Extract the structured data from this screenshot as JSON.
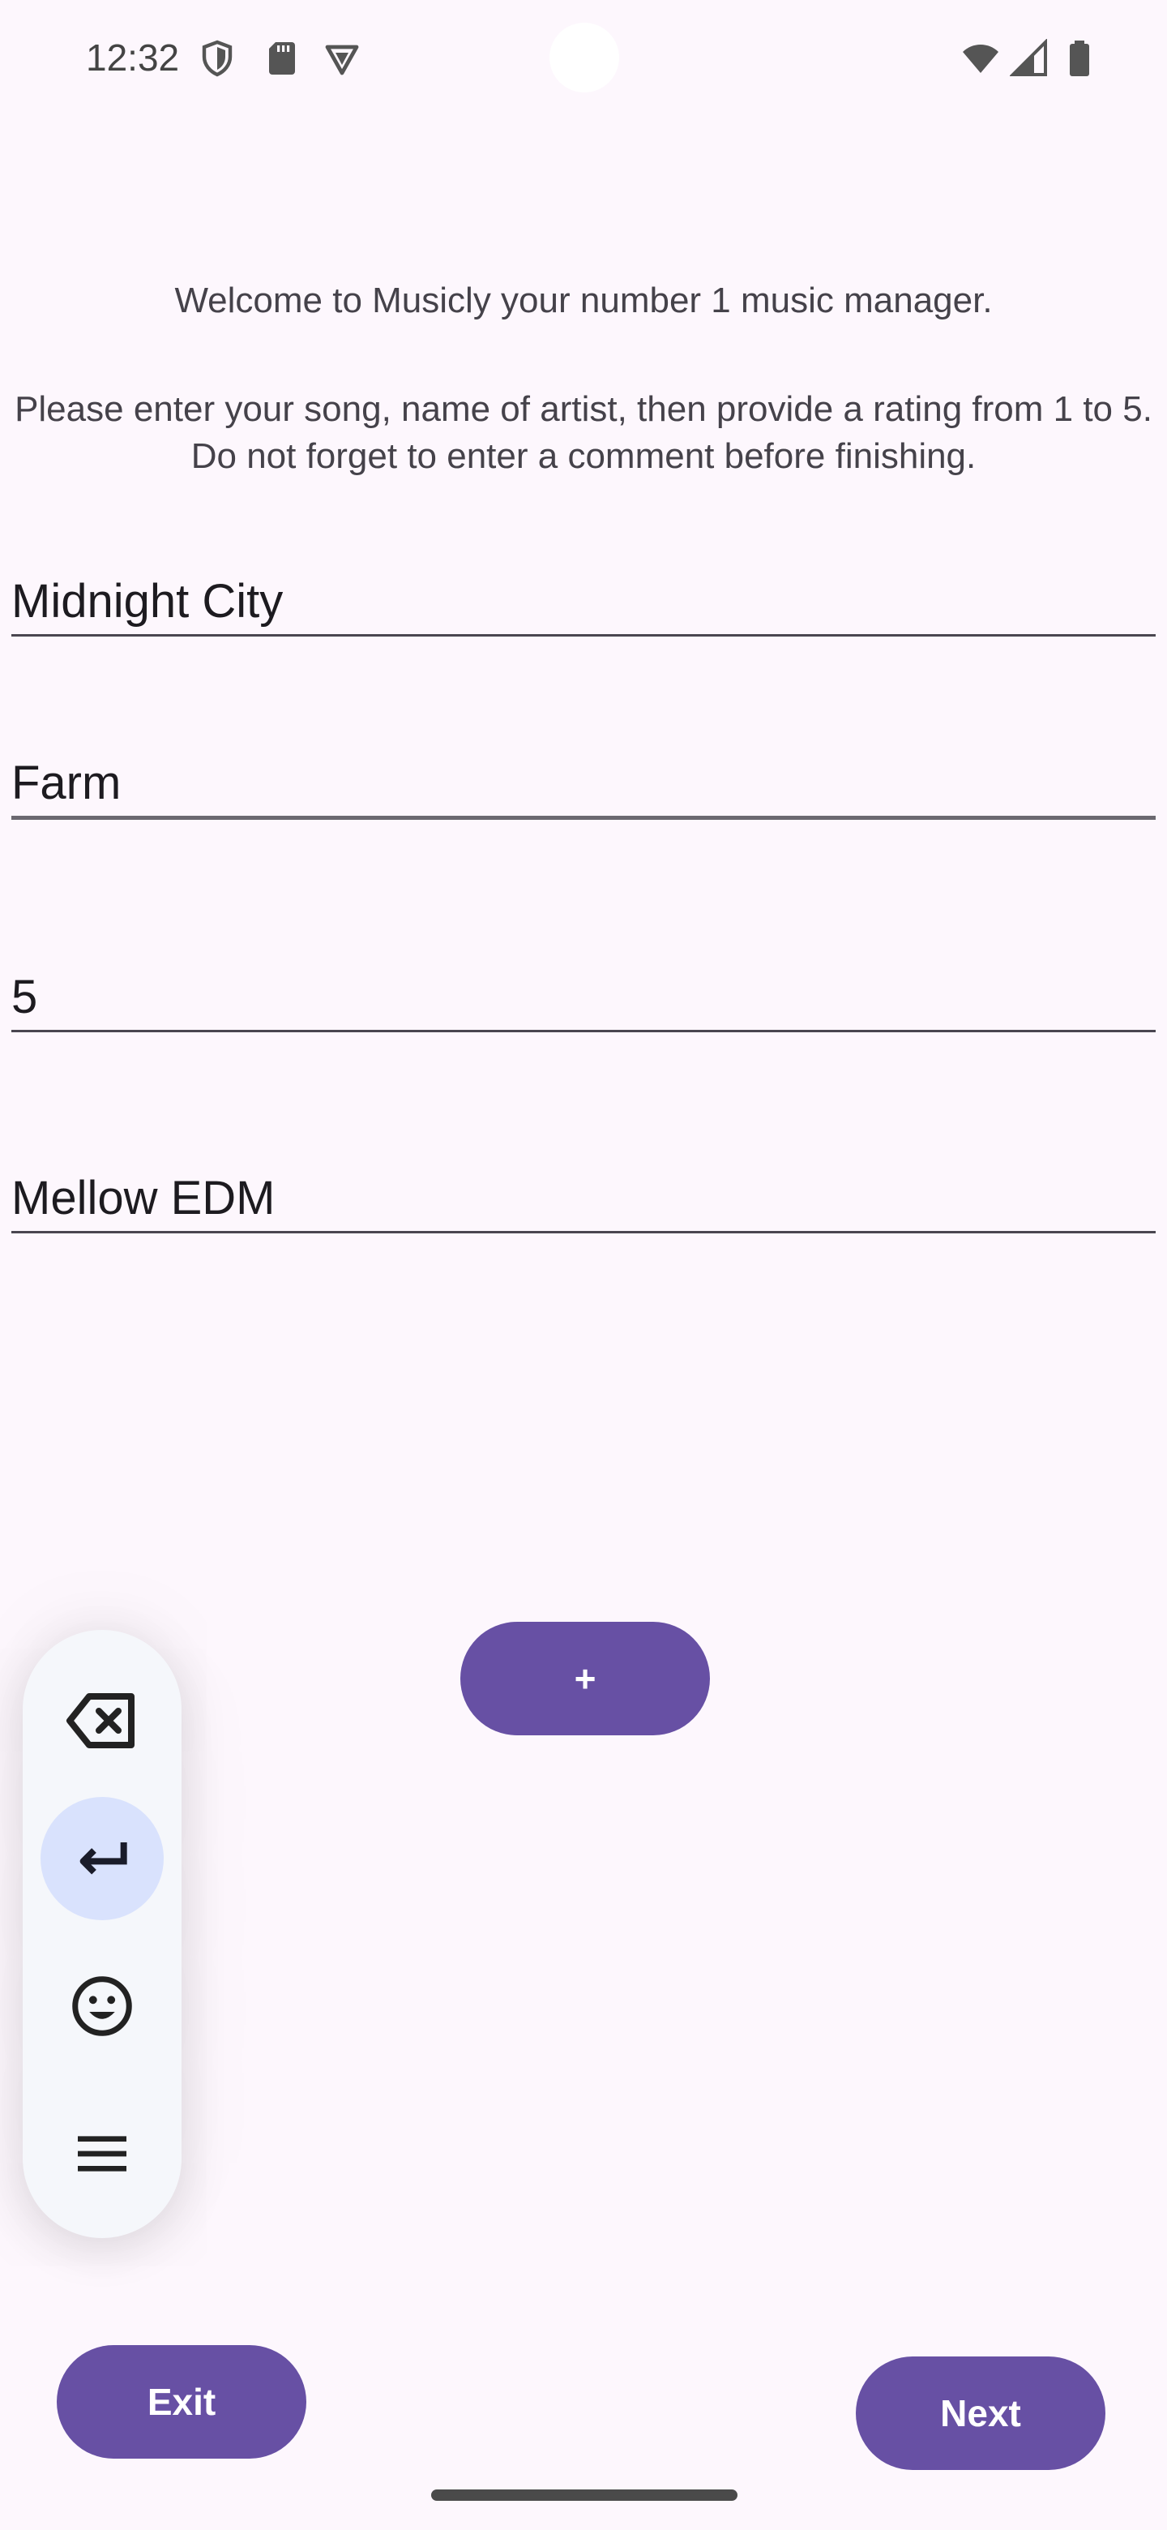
{
  "status_bar": {
    "time": "12:32",
    "icons": [
      "shield-icon",
      "sd-card-icon",
      "vpn-icon",
      "wifi-icon",
      "cell-signal-icon",
      "battery-icon"
    ]
  },
  "intro": {
    "welcome": "Welcome to Musicly your number 1 music manager.",
    "instructions": "Please enter your song, name of artist, then provide a rating from 1 to 5. Do not forget to enter a comment before finishing."
  },
  "form": {
    "song": "Midnight City",
    "artist": "Farm",
    "rating": "5",
    "comment": "Mellow EDM"
  },
  "buttons": {
    "add": "+",
    "exit": "Exit",
    "next": "Next"
  },
  "keyboard_toolbar": {
    "items": [
      "backspace-icon",
      "enter-icon",
      "emoji-icon",
      "menu-icon"
    ]
  },
  "colors": {
    "background": "#fdf7fd",
    "accent": "#6750a4",
    "toolbar_active": "#d9e2fd"
  }
}
